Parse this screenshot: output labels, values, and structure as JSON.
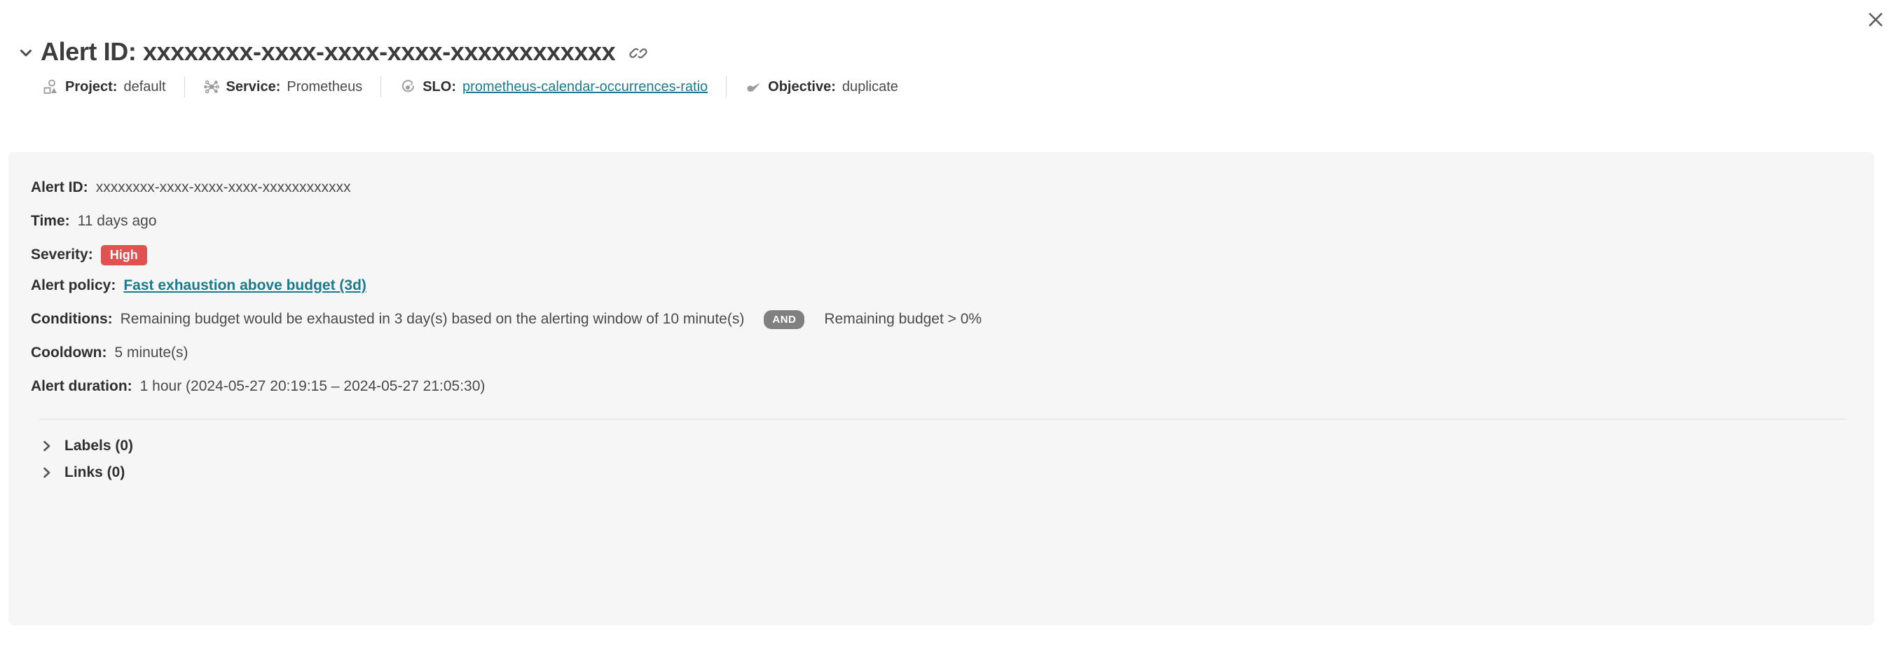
{
  "window": {
    "close_icon": "close-icon"
  },
  "header": {
    "collapse_icon": "chevron-down-icon",
    "title": "Alert ID: xxxxxxxx-xxxx-xxxx-xxxx-xxxxxxxxxxxx",
    "copy_link_icon": "link-icon",
    "meta": [
      {
        "icon": "shapes-icon",
        "label": "Project:",
        "value": "default",
        "is_link": false
      },
      {
        "icon": "service-hub-icon",
        "label": "Service:",
        "value": "Prometheus",
        "is_link": false
      },
      {
        "icon": "target-icon",
        "label": "SLO:",
        "value": "prometheus-calendar-occurrences-ratio",
        "is_link": true
      },
      {
        "icon": "dart-icon",
        "label": "Objective:",
        "value": "duplicate",
        "is_link": false
      }
    ]
  },
  "details": {
    "alert_id": {
      "label": "Alert ID:",
      "value": "xxxxxxxx-xxxx-xxxx-xxxx-xxxxxxxxxxxx"
    },
    "time": {
      "label": "Time:",
      "value": "11 days ago"
    },
    "severity": {
      "label": "Severity:",
      "badge": "High",
      "badge_color": "#e05151"
    },
    "alert_policy": {
      "label": "Alert policy:",
      "value": "Fast exhaustion above budget (3d)"
    },
    "conditions": {
      "label": "Conditions:",
      "first": "Remaining budget would be exhausted in 3 day(s) based on the alerting window of 10 minute(s)",
      "operator": "AND",
      "operator_color": "#808080",
      "second": "Remaining budget > 0%"
    },
    "cooldown": {
      "label": "Cooldown:",
      "value": "5 minute(s)"
    },
    "alert_duration": {
      "label": "Alert duration:",
      "value": "1 hour (2024-05-27 20:19:15 – 2024-05-27 21:05:30)"
    }
  },
  "sections": [
    {
      "icon": "chevron-right-icon",
      "label": "Labels (0)"
    },
    {
      "icon": "chevron-right-icon",
      "label": "Links (0)"
    }
  ],
  "colors": {
    "link": "#1b7b8c",
    "panel_bg": "#f6f6f6",
    "severity_high": "#e05151",
    "operator_badge": "#808080",
    "text": "#3c3c3c"
  }
}
